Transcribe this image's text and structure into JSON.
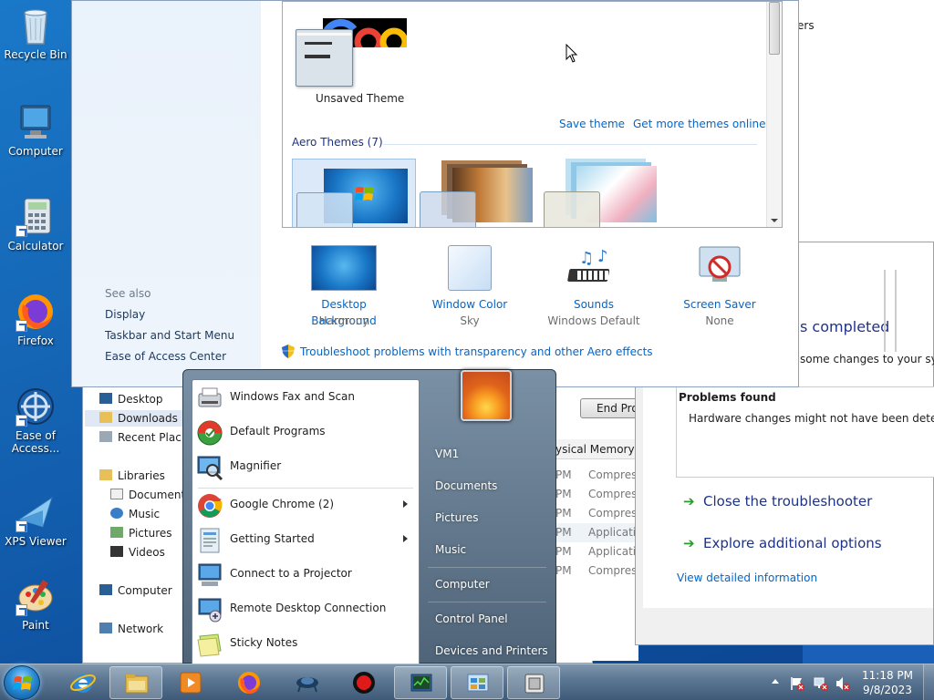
{
  "desktop": {
    "icons": [
      {
        "label": "Recycle Bin"
      },
      {
        "label": "Computer"
      },
      {
        "label": "Calculator"
      },
      {
        "label": "Firefox"
      },
      {
        "label": "Ease of Access..."
      },
      {
        "label": "XPS Viewer"
      },
      {
        "label": "Paint"
      }
    ]
  },
  "personalization": {
    "current_theme_name": "Unsaved Theme",
    "save_theme": "Save theme",
    "more_themes": "Get more themes online",
    "aero_header": "Aero Themes (7)",
    "see_also": "See also",
    "see_also_links": [
      "Display",
      "Taskbar and Start Menu",
      "Ease of Access Center"
    ],
    "bottom": [
      {
        "title": "Desktop Background",
        "value": "Harmony",
        "icon": "desktop-background-icon"
      },
      {
        "title": "Window Color",
        "value": "Sky",
        "icon": "window-color-icon"
      },
      {
        "title": "Sounds",
        "value": "Windows Default",
        "icon": "sounds-icon"
      },
      {
        "title": "Screen Saver",
        "value": "None",
        "icon": "screen-saver-icon"
      }
    ],
    "troubleshoot_link": "Troubleshoot problems with transparency and other Aero effects",
    "header_fragment": "ers"
  },
  "explorer": {
    "nav": [
      {
        "label": "Desktop"
      },
      {
        "label": "Downloads"
      },
      {
        "label": "Recent Plac"
      },
      {
        "label": "Libraries"
      },
      {
        "label": "Documents"
      },
      {
        "label": "Music"
      },
      {
        "label": "Pictures"
      },
      {
        "label": "Videos"
      },
      {
        "label": "Computer"
      },
      {
        "label": "Network"
      }
    ]
  },
  "taskmgr": {
    "end_button": "End Proc",
    "memory_label": "ysical Memory:",
    "rows": [
      {
        "time": "PM",
        "attr": "Compres"
      },
      {
        "time": "PM",
        "attr": "Compres"
      },
      {
        "time": "PM",
        "attr": "Compres"
      },
      {
        "time": "PM",
        "attr": "Applicati"
      },
      {
        "time": "PM",
        "attr": "Applicati"
      },
      {
        "time": "PM",
        "attr": "Compres"
      }
    ]
  },
  "troubleshooter": {
    "status_fragment": "s completed",
    "sub_fragment": "some changes to your syste",
    "problems_header": "Problems found",
    "problem_text": "Hardware changes might not have been detected",
    "close_option": "Close the troubleshooter",
    "explore_option": "Explore additional options",
    "detail_link": "View detailed information"
  },
  "startmenu": {
    "programs": [
      {
        "label": "Windows Fax and Scan",
        "icon": "fax-scan-icon",
        "submenu": false
      },
      {
        "label": "Default Programs",
        "icon": "default-programs-icon",
        "submenu": false
      },
      {
        "label": "Magnifier",
        "icon": "magnifier-icon",
        "submenu": false
      },
      {
        "label": "Google Chrome (2)",
        "icon": "chrome-icon",
        "submenu": true
      },
      {
        "label": "Getting Started",
        "icon": "getting-started-icon",
        "submenu": true
      },
      {
        "label": "Connect to a Projector",
        "icon": "projector-icon",
        "submenu": false
      },
      {
        "label": "Remote Desktop Connection",
        "icon": "remote-desktop-icon",
        "submenu": false
      },
      {
        "label": "Sticky Notes",
        "icon": "sticky-notes-icon",
        "submenu": false
      }
    ],
    "right": [
      "VM1",
      "Documents",
      "Pictures",
      "Music",
      "Computer",
      "Control Panel",
      "Devices and Printers"
    ]
  },
  "taskbar": {
    "items": [
      "internet-explorer-icon",
      "explorer-icon",
      "media-player-icon",
      "firefox-icon",
      "network-monitor-icon",
      "record-icon",
      "task-manager-icon",
      "control-panel-icon",
      "troubleshooter-icon"
    ],
    "time": "11:18 PM",
    "date": "9/8/2023"
  }
}
